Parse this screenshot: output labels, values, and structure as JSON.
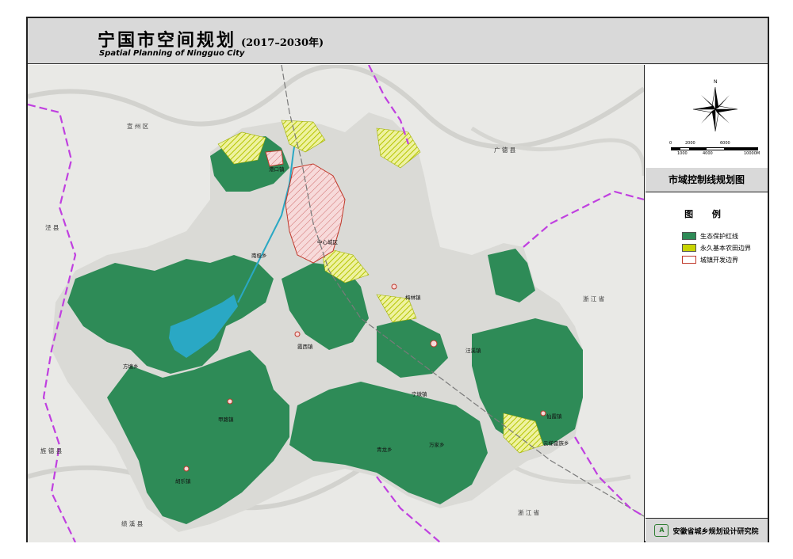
{
  "header": {
    "title": "宁国市空间规划",
    "years": "(2017–2030年)",
    "subtitle": "Spatial Planning of Ningguo City"
  },
  "compass": {
    "north_label": "N"
  },
  "scale_bar": {
    "ticks_top": [
      "0",
      "2000",
      "6000"
    ],
    "ticks_bottom": [
      "1000",
      "4000",
      "10000M"
    ]
  },
  "panel": {
    "title": "市域控制线规划图"
  },
  "legend": {
    "title": "图 例",
    "items": [
      {
        "label": "生态保护红线",
        "color": "#2e8b57"
      },
      {
        "label": "永久基本农田边界",
        "color": "#c8d400"
      },
      {
        "label": "城镇开发边界",
        "color": "#ffffff"
      }
    ]
  },
  "institute": {
    "name": "安徽省城乡规划设计研究院"
  },
  "map": {
    "neighbor_labels": {
      "xuanzhou": "宣 州 区",
      "guangde": "广 德 县",
      "jingxian": "泾 县",
      "zhejiang_e": "浙 江 省",
      "jingde": "旌 德 县",
      "jixi": "绩 溪 县",
      "zhejiang_s": "浙 江 省"
    },
    "town_labels": {
      "t1": "港口镇",
      "t2": "中心城区",
      "t3": "南极乡",
      "t4": "梅林镇",
      "t5": "霞西镇",
      "t6": "方塘乡",
      "t7": "甲路镇",
      "t8": "宁墩镇",
      "t9": "青龙乡",
      "t10": "万家乡",
      "t11": "胡乐镇",
      "t12": "仙霞镇",
      "t13": "云梯畲族乡",
      "t14": "汪溪镇"
    },
    "colors": {
      "hillshade": "#e9e9e6",
      "county_fill": "#dcdcd8",
      "eco_green": "#2e8b57",
      "farmland": "#c8d400",
      "reservoir": "#2aa8c4",
      "boundary": "#c040e0",
      "urban_edge": "#c0392b"
    }
  }
}
